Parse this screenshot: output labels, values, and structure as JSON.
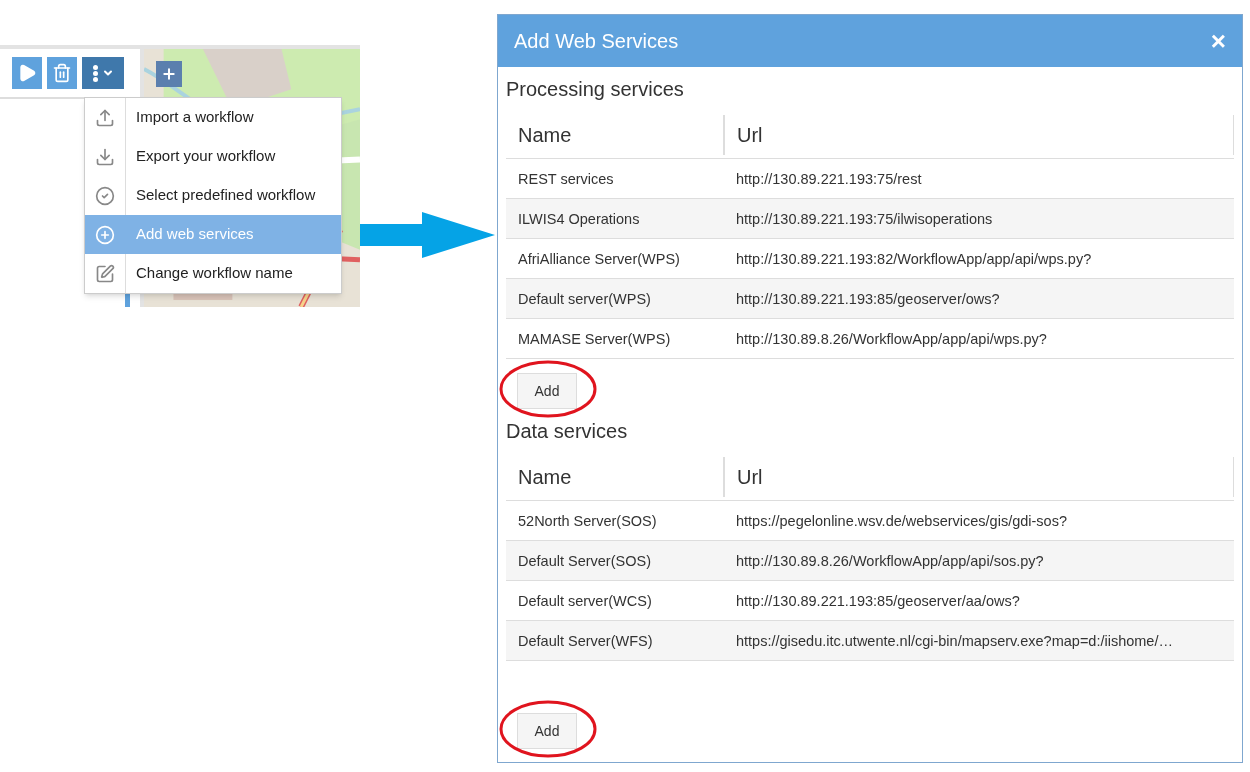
{
  "toolbar": {
    "buttons": [
      {
        "kind": "run",
        "selected": false
      },
      {
        "kind": "delete",
        "selected": false
      },
      {
        "kind": "more",
        "selected": true
      }
    ]
  },
  "menu": {
    "items": [
      {
        "label": "Import a workflow",
        "selected": false
      },
      {
        "label": "Export your workflow",
        "selected": false
      },
      {
        "label": "Select predefined workflow",
        "selected": false
      },
      {
        "label": "Add web services",
        "selected": true
      },
      {
        "label": "Change workflow name",
        "selected": false
      }
    ]
  },
  "dialog": {
    "title": "Add Web Services",
    "close": "×",
    "sections": [
      {
        "title": "Processing services",
        "columns": [
          "Name",
          "Url"
        ],
        "button": "Add",
        "rows": [
          [
            "REST services",
            "http://130.89.221.193:75/rest"
          ],
          [
            "ILWIS4 Operations",
            "http://130.89.221.193:75/ilwisoperations"
          ],
          [
            "AfriAlliance Server(WPS)",
            "http://130.89.221.193:82/WorkflowApp/app/api/wps.py?"
          ],
          [
            "Default server(WPS)",
            "http://130.89.221.193:85/geoserver/ows?"
          ],
          [
            "MAMASE Server(WPS)",
            "http://130.89.8.26/WorkflowApp/app/api/wps.py?"
          ]
        ]
      },
      {
        "title": "Data services",
        "columns": [
          "Name",
          "Url"
        ],
        "button": "Add",
        "rows": [
          [
            "52North Server(SOS)",
            "https://pegelonline.wsv.de/webservices/gis/gdi-sos?"
          ],
          [
            "Default Server(SOS)",
            "http://130.89.8.26/WorkflowApp/app/api/sos.py?"
          ],
          [
            "Default server(WCS)",
            "http://130.89.221.193:85/geoserver/aa/ows?"
          ],
          [
            "Default Server(WFS)",
            "https://gisedu.itc.utwente.nl/cgi-bin/mapserv.exe?map=d:/iishome/…"
          ]
        ]
      }
    ]
  }
}
